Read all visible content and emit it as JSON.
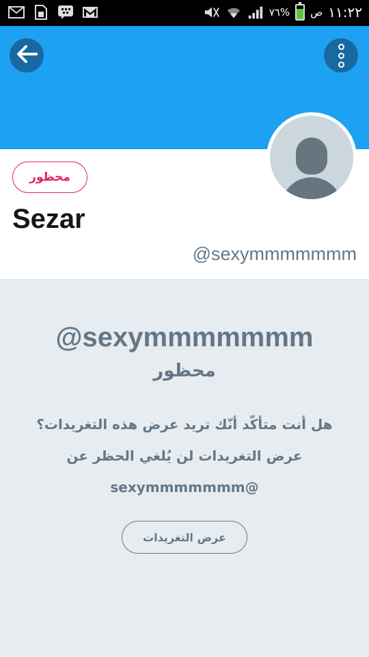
{
  "status_bar": {
    "time": "١١:٢٢",
    "am_pm": "ص",
    "battery": "٧٦%",
    "battery_level": 0.76,
    "icons": [
      "mail-icon",
      "sim-card-icon",
      "bbm-icon",
      "gmail-icon",
      "mute-icon",
      "wifi-icon",
      "signal-icon",
      "battery-icon"
    ]
  },
  "header": {
    "back_icon": "arrow-left-icon",
    "more_icon": "more-vertical-icon",
    "banner_color": "#1da1f2"
  },
  "profile": {
    "blocked_badge": "محظور",
    "display_name": "Sezar",
    "handle": "@sexymmmmmmm",
    "avatar": "default-avatar-icon"
  },
  "notice": {
    "handle": "@sexymmmmmmm",
    "status": "محظور",
    "message": "هل أنت متأكّد أنّك تريد عرض هذه التغريدات؟ عرض التغريدات لن يُلغي الحظر عن @sexymmmmmmm",
    "view_button": "عرض التغريدات"
  },
  "colors": {
    "accent": "#1da1f2",
    "blocked": "#e0245e",
    "muted_text": "#657786"
  }
}
